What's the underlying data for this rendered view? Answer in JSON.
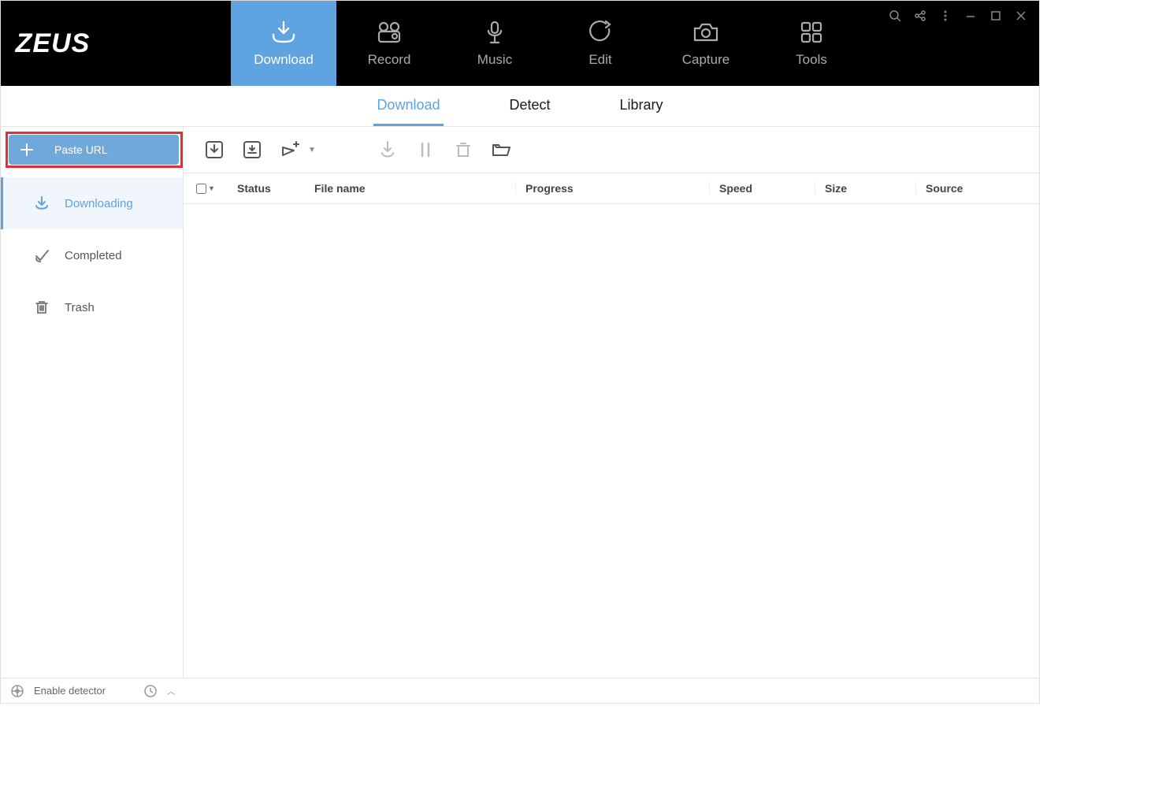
{
  "app_name": "ZEUS",
  "nav": {
    "download": "Download",
    "record": "Record",
    "music": "Music",
    "edit": "Edit",
    "capture": "Capture",
    "tools": "Tools"
  },
  "subtabs": {
    "download": "Download",
    "detect": "Detect",
    "library": "Library"
  },
  "sidebar": {
    "paste_url": "Paste URL",
    "downloading": "Downloading",
    "completed": "Completed",
    "trash": "Trash"
  },
  "columns": {
    "status": "Status",
    "file_name": "File name",
    "progress": "Progress",
    "speed": "Speed",
    "size": "Size",
    "source": "Source"
  },
  "status_bar": {
    "enable_detector": "Enable detector"
  }
}
